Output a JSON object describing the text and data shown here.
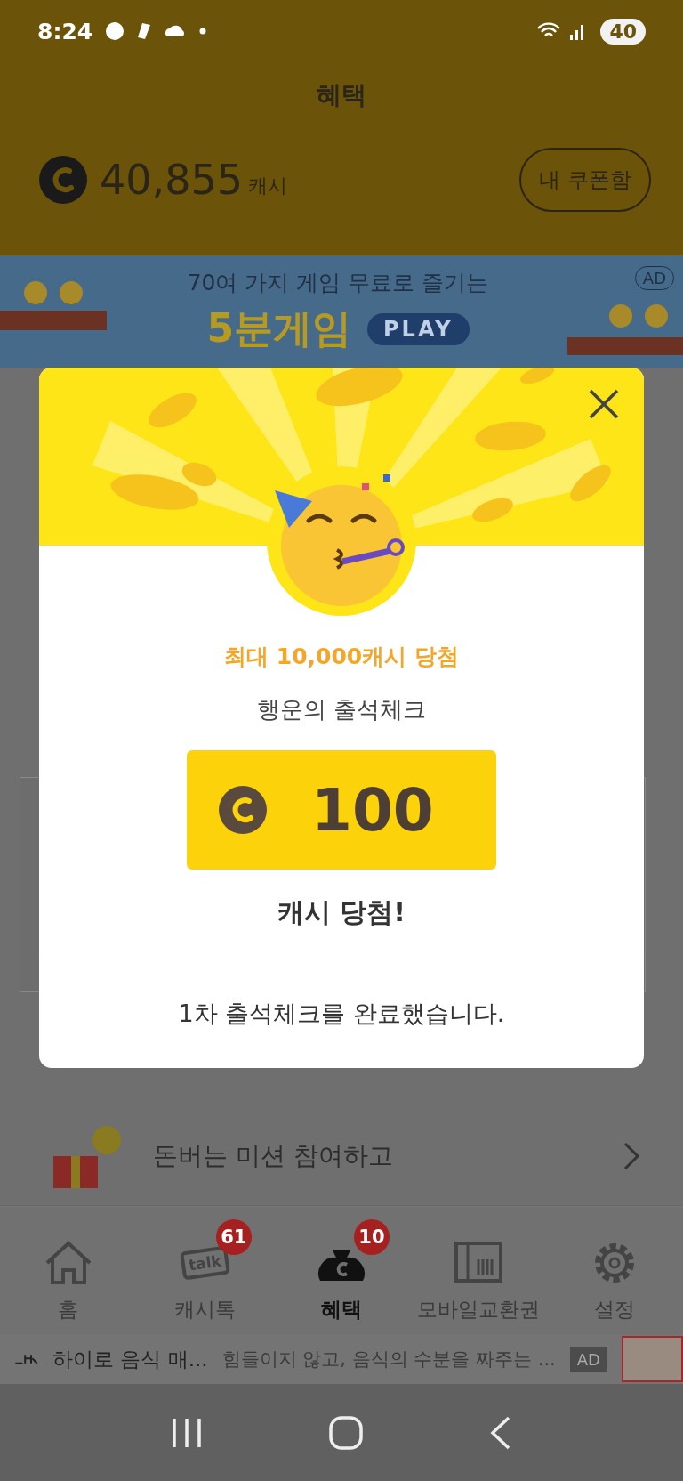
{
  "status_bar": {
    "time": "8:24",
    "battery": "40"
  },
  "header": {
    "title": "혜택",
    "balance": "40,855",
    "unit": "캐시",
    "coupon_button": "내 쿠폰함"
  },
  "banner": {
    "line_1": "70여 가지 게임 무료로 즐기는",
    "title": "5분게임",
    "play": "PLAY",
    "ad_badge": "AD"
  },
  "mission": {
    "text": "돈버는 미션 참여하고"
  },
  "modal": {
    "headline": "최대 10,000캐시 당첨",
    "subtitle": "행운의 출석체크",
    "amount": "100",
    "result": "캐시 당첨!",
    "message": "1차 출석체크를 완료했습니다."
  },
  "tabs": [
    {
      "label": "홈",
      "kind": "home",
      "selected": false
    },
    {
      "label": "캐시톡",
      "kind": "talk",
      "icon_text": "talk",
      "badge": "61",
      "selected": false
    },
    {
      "label": "혜택",
      "kind": "benefit",
      "badge": "10",
      "selected": true
    },
    {
      "label": "모바일교환권",
      "kind": "coupon",
      "selected": false
    },
    {
      "label": "설정",
      "kind": "settings",
      "selected": false
    }
  ],
  "ad_bar": {
    "title": "하이로 음식 매...",
    "text": "힘들이지 않고, 음식의 수분을 짜주는 ...",
    "badge": "AD"
  }
}
